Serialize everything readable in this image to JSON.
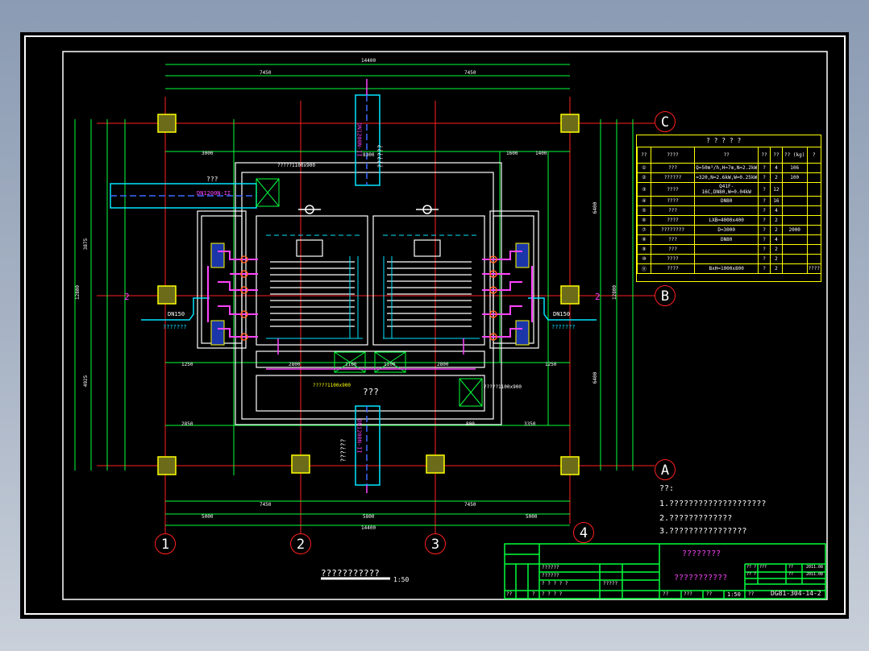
{
  "drawing": {
    "title": "???????????",
    "scale": "1:50",
    "plant_label": "???",
    "grid_numbers": [
      "1",
      "2",
      "3",
      "4"
    ],
    "grid_letters": [
      "C",
      "B",
      "A"
    ],
    "section_markers": [
      "2",
      "2"
    ],
    "dims": {
      "top_total": "14400",
      "top_left": "7450",
      "top_right": "7450",
      "bottom_total": "14400",
      "bottom_left": "7450",
      "bottom_right": "7450",
      "bottom_mid": "5800",
      "bottom_a": "5000",
      "bottom_b": "5000",
      "left_total": "12800",
      "left_upper": "3875",
      "left_lower": "4925",
      "right_total": "12800",
      "right_upper": "6400",
      "right_lower": "6400",
      "inner_top": "8300",
      "row_mid_a": "1250",
      "row_mid_b": "2800",
      "row_mid_c": "1100",
      "row_mid_d": "1100",
      "row_mid_e": "2800",
      "row_mid_f": "1250",
      "upper_a": "3000",
      "upper_b": "1600",
      "upper_c": "1400",
      "lower_a": "2850",
      "lower_b": "3350",
      "lower_c": "800"
    },
    "labels": {
      "pipe_top": "DN1200N-II",
      "pipe_top_note": "??????",
      "pipe_left": "DN1200N-II",
      "pipe_left_note": "???",
      "pipe_bottom": "DN1200N-II",
      "pipe_bottom_note": "??????",
      "dn150_left": "DN150",
      "dn150_right": "DN150",
      "hatch_note_top": "?????1100x900",
      "hatch_note_mid": "?????1100x900",
      "hatch_note_right": "?????1100x900",
      "drain_left": "???????",
      "drain_right": "???????"
    }
  },
  "equipment_table": {
    "title": "? ? ? ? ?",
    "headers": [
      "??",
      "????",
      "??",
      "??",
      "??",
      "?? (kg)",
      "?"
    ],
    "subheader": "?",
    "rows": [
      [
        "①",
        "???",
        "Q=50m³/h,H=7m,N=2.2kW",
        "?",
        "4",
        "106",
        ""
      ],
      [
        "②",
        "??????",
        "=320,N=2.6kW,W=0.25kW",
        "?",
        "2",
        "100",
        ""
      ],
      [
        "③",
        "????",
        "Q41F-16C,DN80,W=0.04kW",
        "?",
        "12",
        "",
        ""
      ],
      [
        "④",
        "????",
        "DN80",
        "?",
        "16",
        "",
        ""
      ],
      [
        "⑤",
        "???",
        "",
        "?",
        "4",
        "",
        ""
      ],
      [
        "⑥",
        "????",
        "LXB=4000x400",
        "?",
        "2",
        "",
        ""
      ],
      [
        "⑦",
        "????????",
        "D=3000",
        "?",
        "2",
        "2000",
        ""
      ],
      [
        "⑧",
        "???",
        "DN80",
        "?",
        "4",
        "",
        ""
      ],
      [
        "⑨",
        "???",
        "",
        "?",
        "2",
        "",
        ""
      ],
      [
        "⑩",
        "????",
        "",
        "?",
        "2",
        "",
        ""
      ],
      [
        "⑪",
        "????",
        "BxH=1000x800",
        "?",
        "2",
        "",
        "????"
      ]
    ]
  },
  "notes": {
    "heading": "??:",
    "items": [
      "1.????????????????????",
      "2.?????????????",
      "3.????????????????"
    ]
  },
  "title_block": {
    "project": "????????",
    "drawing_name": "???????????",
    "drawing_no": "DG81-304-14-2",
    "scale": "1:50",
    "date1": "2011.08",
    "date2": "2011.08",
    "cells": [
      "??????",
      "??????",
      "? ? ? ? ?",
      "? ? ? ?",
      "?????",
      "??",
      "???",
      "??",
      "??",
      "?? ?",
      "?? ?",
      "??",
      "???",
      "??",
      "??",
      "?"
    ]
  }
}
